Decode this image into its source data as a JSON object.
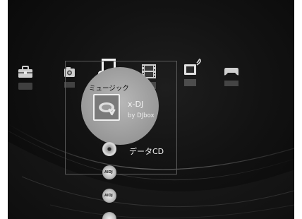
{
  "category_bar": {
    "items": [
      {
        "name": "toolbox-icon"
      },
      {
        "name": "photo-icon"
      },
      {
        "name": "music-icon"
      },
      {
        "name": "video-icon"
      },
      {
        "name": "tv-icon"
      },
      {
        "name": "game-icon"
      }
    ],
    "selected_label": "ミュージック"
  },
  "music_list": {
    "selected_item": {
      "title": "x-DJ",
      "subtitle": "by DJbox",
      "thumb_text": "DJ"
    },
    "items": [
      {
        "label": "データCD",
        "icon": "disc-icon"
      },
      {
        "label": "",
        "icon": "aidj-icon",
        "logo": "AIDJ"
      },
      {
        "label": "",
        "icon": "aidj-icon",
        "logo": "AIDJ"
      }
    ]
  },
  "colors": {
    "background": "#0e0e0e",
    "icon": "#d8d8d8",
    "highlight": "#a8a8a8"
  }
}
